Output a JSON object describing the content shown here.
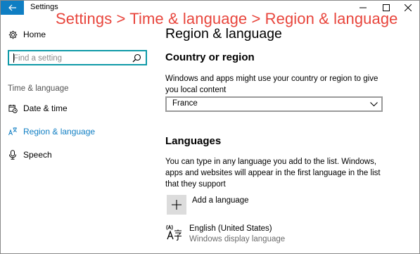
{
  "window": {
    "title": "Settings",
    "annotation": "Settings > Time & language > Region & language"
  },
  "sidebar": {
    "home_label": "Home",
    "search_placeholder": "Find a setting",
    "section_label": "Time & language",
    "items": [
      {
        "label": "Date & time",
        "icon": "date-time-icon"
      },
      {
        "label": "Region & language",
        "icon": "region-language-icon",
        "active": true
      },
      {
        "label": "Speech",
        "icon": "microphone-icon"
      }
    ]
  },
  "main": {
    "title": "Region & language",
    "country_heading": "Country or region",
    "country_description": "Windows and apps might use your country or region to give you local content",
    "country_selected": "France",
    "languages_heading": "Languages",
    "languages_description": "You can type in any language you add to the list. Windows, apps and websites will appear in the first language in the list that they support",
    "add_language_label": "Add a language",
    "language_entries": [
      {
        "name": "English (United States)",
        "detail": "Windows display language"
      }
    ]
  },
  "colors": {
    "accent": "#0f7ec3",
    "annotation": "#e8453c",
    "search_border": "#0f9aa8"
  }
}
